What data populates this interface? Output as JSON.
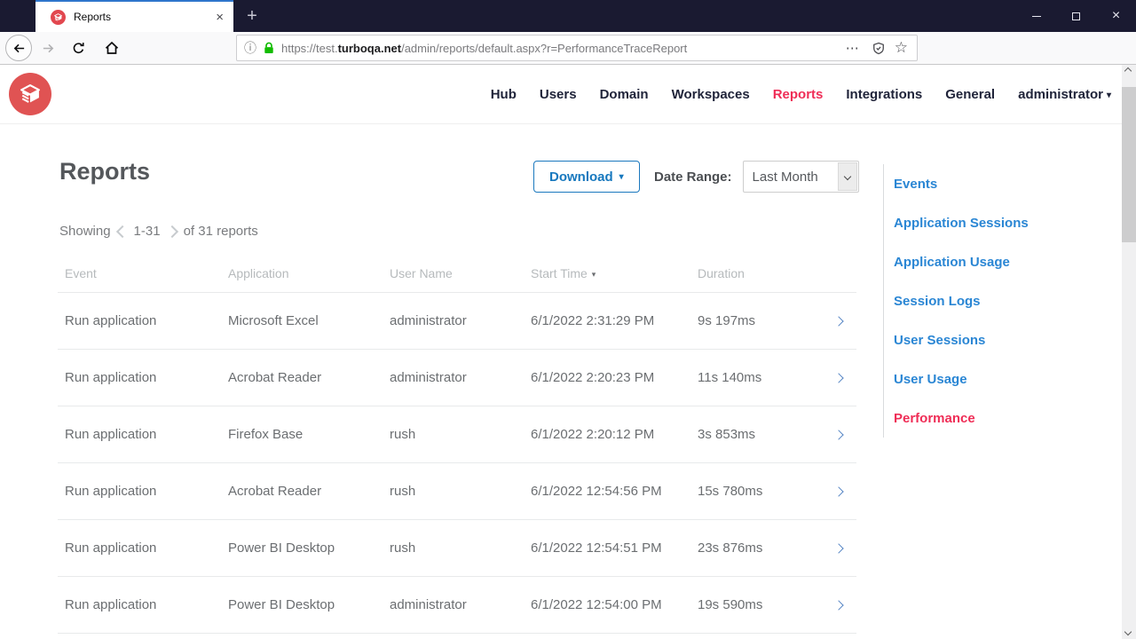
{
  "colors": {
    "titlebar_bg": "#1a1a31",
    "tab_accent_blue": "#2e76cc",
    "brand_red": "#e05353",
    "active_link_red": "#ef2d56",
    "button_blue": "#1778be",
    "sidebar_link_blue": "#2a86d4",
    "lock_green": "#12bc00"
  },
  "icons": {
    "new_tab_glyph": "+",
    "tab_close_glyph": "×",
    "window_close_glyph": "×",
    "info_glyph": "ⓘ",
    "dots_glyph": "⋯",
    "star_glyph": "☆",
    "caret_down_glyph": "▾"
  },
  "browser": {
    "tab_title": "Reports",
    "url_pre": "https://test.",
    "url_domain": "turboqa.net",
    "url_path": "/admin/reports/default.aspx?r=PerformanceTraceReport"
  },
  "nav": {
    "items": [
      "Hub",
      "Users",
      "Domain",
      "Workspaces",
      "Reports",
      "Integrations",
      "General"
    ],
    "active_item": "Reports",
    "user_menu": "administrator"
  },
  "page": {
    "title": "Reports",
    "download_button": "Download",
    "date_range_label": "Date Range:",
    "date_range_value": "Last Month",
    "showing_prefix": "Showing",
    "showing_range": "1-31",
    "showing_suffix": "of 31 reports",
    "table": {
      "columns": [
        "Event",
        "Application",
        "User Name",
        "Start Time",
        "Duration"
      ],
      "sorted_column": "Start Time",
      "rows": [
        {
          "event": "Run application",
          "application": "Microsoft Excel",
          "user": "administrator",
          "start": "6/1/2022 2:31:29 PM",
          "duration": "9s 197ms"
        },
        {
          "event": "Run application",
          "application": "Acrobat Reader",
          "user": "administrator",
          "start": "6/1/2022 2:20:23 PM",
          "duration": "11s 140ms"
        },
        {
          "event": "Run application",
          "application": "Firefox Base",
          "user": "rush",
          "start": "6/1/2022 2:20:12 PM",
          "duration": "3s 853ms"
        },
        {
          "event": "Run application",
          "application": "Acrobat Reader",
          "user": "rush",
          "start": "6/1/2022 12:54:56 PM",
          "duration": "15s 780ms"
        },
        {
          "event": "Run application",
          "application": "Power BI Desktop",
          "user": "rush",
          "start": "6/1/2022 12:54:51 PM",
          "duration": "23s 876ms"
        },
        {
          "event": "Run application",
          "application": "Power BI Desktop",
          "user": "administrator",
          "start": "6/1/2022 12:54:00 PM",
          "duration": "19s 590ms"
        }
      ]
    },
    "sidebar": {
      "links": [
        "Events",
        "Application Sessions",
        "Application Usage",
        "Session Logs",
        "User Sessions",
        "User Usage",
        "Performance"
      ],
      "active_link": "Performance"
    }
  }
}
